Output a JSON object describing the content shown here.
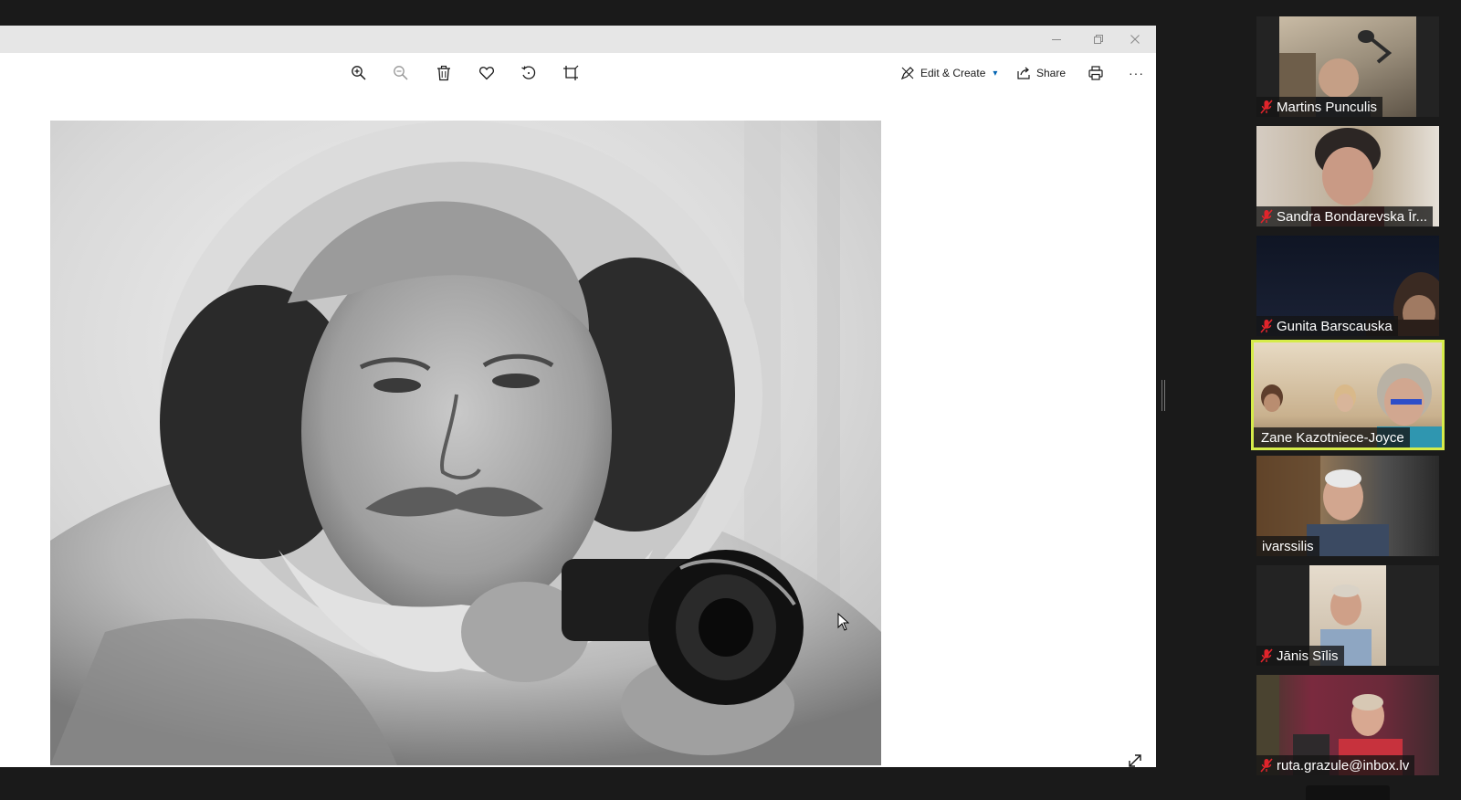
{
  "window_controls": {
    "minimize_icon": "minimize-icon",
    "restore_icon": "restore-icon",
    "close_icon": "close-icon"
  },
  "toolbar": {
    "edit_create_label": "Edit & Create",
    "share_label": "Share",
    "more_label": "···"
  },
  "participants": [
    {
      "name": "Martins Punculis",
      "muted": true
    },
    {
      "name": "Sandra Bondarevska Īr...",
      "muted": true
    },
    {
      "name": "Gunita Barscauska",
      "muted": true
    },
    {
      "name": "Zane Kazotniece-Joyce",
      "muted": false,
      "active_speaker": true
    },
    {
      "name": "ivarssilis",
      "muted": false
    },
    {
      "name": "Jānis Sīlis",
      "muted": true
    },
    {
      "name": "ruta.grazule@inbox.lv",
      "muted": true
    }
  ],
  "colors": {
    "active_speaker_border": "#d6ec4a",
    "mute_icon": "#e0242b",
    "accent": "#0063b1"
  }
}
